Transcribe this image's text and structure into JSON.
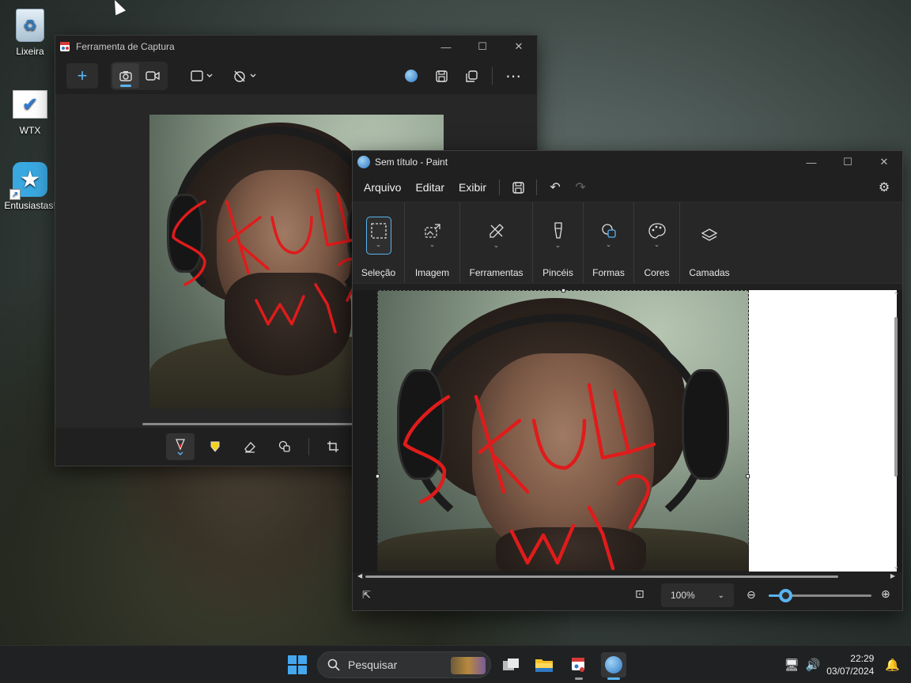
{
  "desktop": {
    "icons": [
      {
        "label": "Lixeira",
        "icon": "recycle-bin-icon"
      },
      {
        "label": "WTX",
        "icon": "checkmark-app-icon"
      },
      {
        "label": "Entusiastas!",
        "icon": "star-shortcut-icon"
      }
    ]
  },
  "snipping_tool": {
    "title": "Ferramenta de Captura",
    "toolbar": {
      "new": "+",
      "modes": [
        "screenshot-mode-icon",
        "video-mode-icon"
      ],
      "shape": "rectangle-snip-icon",
      "timer": "no-delay-timer-icon",
      "more": "⋯"
    },
    "annotation_tools": [
      "ballpoint-pen-icon",
      "highlighter-icon",
      "eraser-icon",
      "shapes-icon",
      "crop-icon",
      "text-actions-icon"
    ]
  },
  "paint": {
    "title": "Sem título - Paint",
    "menu": {
      "file": "Arquivo",
      "edit": "Editar",
      "view": "Exibir"
    },
    "ribbon": {
      "selection": "Seleção",
      "image": "Imagem",
      "tools": "Ferramentas",
      "brushes": "Pincéis",
      "shapes": "Formas",
      "colors": "Cores",
      "layers": "Camadas"
    },
    "canvas_annotation": "SKULL W11",
    "zoom": {
      "value": "100%",
      "slider_fraction": 0.16
    },
    "accent": "#5ab4f0"
  },
  "taskbar": {
    "search_placeholder": "Pesquisar",
    "time": "22:29",
    "date": "03/07/2024"
  },
  "colors": {
    "ink": "#e01b1b",
    "window_bg": "#202020"
  }
}
